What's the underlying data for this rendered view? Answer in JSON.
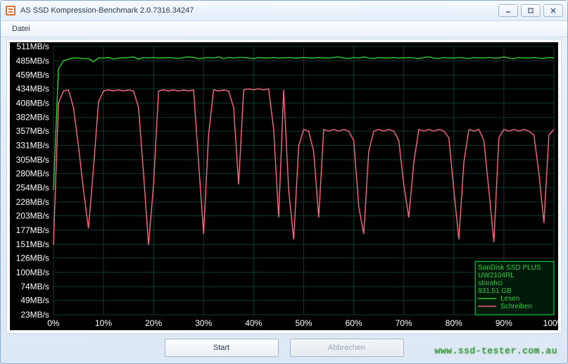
{
  "window": {
    "title": "AS SSD Kompression-Benchmark 2.0.7316.34247",
    "menu_datei": "Datei"
  },
  "buttons": {
    "start": "Start",
    "abbrechen": "Abbrechen"
  },
  "device": {
    "name": "SanDisk SSD PLUS",
    "fw": "UW2104RL",
    "controller": "storahci",
    "capacity": "931,51 GB"
  },
  "legend": {
    "lesen": "Lesen",
    "schreiben": "Schreiben"
  },
  "watermark": "www.ssd-tester.com.au",
  "chart_data": {
    "type": "line",
    "xlabel": "",
    "ylabel": "",
    "xunit": "%",
    "yunit": "MB/s",
    "xlim": [
      0,
      100
    ],
    "ylim": [
      23,
      511
    ],
    "x_ticks": [
      0,
      10,
      20,
      30,
      40,
      50,
      60,
      70,
      80,
      90,
      100
    ],
    "y_ticks": [
      23,
      49,
      74,
      100,
      126,
      151,
      177,
      203,
      228,
      254,
      280,
      305,
      331,
      357,
      382,
      408,
      434,
      459,
      485,
      511
    ],
    "x": [
      0,
      1,
      2,
      3,
      4,
      5,
      6,
      7,
      8,
      9,
      10,
      11,
      12,
      13,
      14,
      15,
      16,
      17,
      18,
      19,
      20,
      21,
      22,
      23,
      24,
      25,
      26,
      27,
      28,
      29,
      30,
      31,
      32,
      33,
      34,
      35,
      36,
      37,
      38,
      39,
      40,
      41,
      42,
      43,
      44,
      45,
      46,
      47,
      48,
      49,
      50,
      51,
      52,
      53,
      54,
      55,
      56,
      57,
      58,
      59,
      60,
      61,
      62,
      63,
      64,
      65,
      66,
      67,
      68,
      69,
      70,
      71,
      72,
      73,
      74,
      75,
      76,
      77,
      78,
      79,
      80,
      81,
      82,
      83,
      84,
      85,
      86,
      87,
      88,
      89,
      90,
      91,
      92,
      93,
      94,
      95,
      96,
      97,
      98,
      99,
      100
    ],
    "series": [
      {
        "name": "Lesen",
        "color": "#33cc33",
        "values": [
          250,
          470,
          485,
          488,
          490,
          490,
          489,
          489,
          483,
          490,
          490,
          491,
          488,
          490,
          490,
          491,
          492,
          488,
          491,
          490,
          491,
          490,
          490,
          491,
          490,
          489,
          491,
          492,
          491,
          489,
          490,
          491,
          490,
          492,
          489,
          491,
          490,
          491,
          491,
          490,
          489,
          491,
          490,
          490,
          491,
          490,
          490,
          491,
          490,
          490,
          491,
          490,
          490,
          491,
          490,
          490,
          491,
          492,
          490,
          489,
          491,
          490,
          492,
          490,
          489,
          491,
          490,
          490,
          491,
          490,
          490,
          491,
          490,
          489,
          491,
          492,
          490,
          489,
          491,
          490,
          490,
          491,
          490,
          489,
          491,
          490,
          490,
          491,
          490,
          490,
          492,
          490,
          489,
          491,
          490,
          490,
          491,
          490,
          489,
          491,
          490
        ]
      },
      {
        "name": "Schreiben",
        "color": "#ff6680",
        "values": [
          150,
          408,
          430,
          432,
          400,
          330,
          250,
          180,
          290,
          410,
          430,
          432,
          430,
          432,
          430,
          432,
          430,
          400,
          280,
          150,
          260,
          430,
          432,
          430,
          432,
          430,
          432,
          430,
          432,
          300,
          170,
          350,
          432,
          430,
          432,
          430,
          400,
          260,
          432,
          434,
          432,
          434,
          432,
          434,
          360,
          200,
          432,
          250,
          160,
          330,
          360,
          357,
          320,
          200,
          360,
          357,
          360,
          357,
          360,
          357,
          340,
          220,
          170,
          320,
          357,
          360,
          357,
          360,
          357,
          340,
          260,
          200,
          300,
          360,
          357,
          360,
          357,
          360,
          357,
          345,
          250,
          160,
          300,
          360,
          357,
          360,
          340,
          250,
          155,
          345,
          360,
          357,
          360,
          357,
          360,
          357,
          350,
          280,
          190,
          350,
          360
        ]
      }
    ]
  }
}
